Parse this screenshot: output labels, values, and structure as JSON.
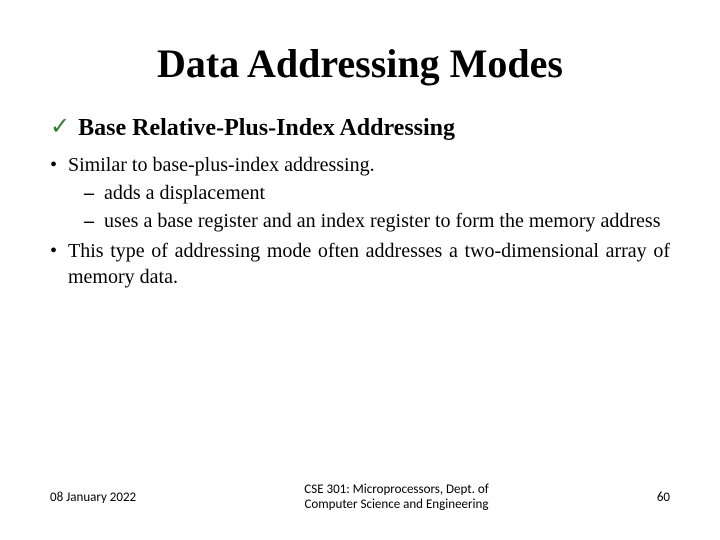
{
  "title": "Data Addressing Modes",
  "subheading": "Base Relative-Plus-Index Addressing",
  "bullets": {
    "b1": "Similar to base-plus-index addressing.",
    "b1a": "adds a displacement",
    "b1b": "uses a base register and an index register to form the memory address",
    "b2": "This type of addressing mode often addresses a two-dimensional array of memory data."
  },
  "footer": {
    "date": "08 January 2022",
    "center_line1": "CSE 301: Microprocessors, Dept. of",
    "center_line2": "Computer Science and Engineering",
    "page": "60"
  }
}
